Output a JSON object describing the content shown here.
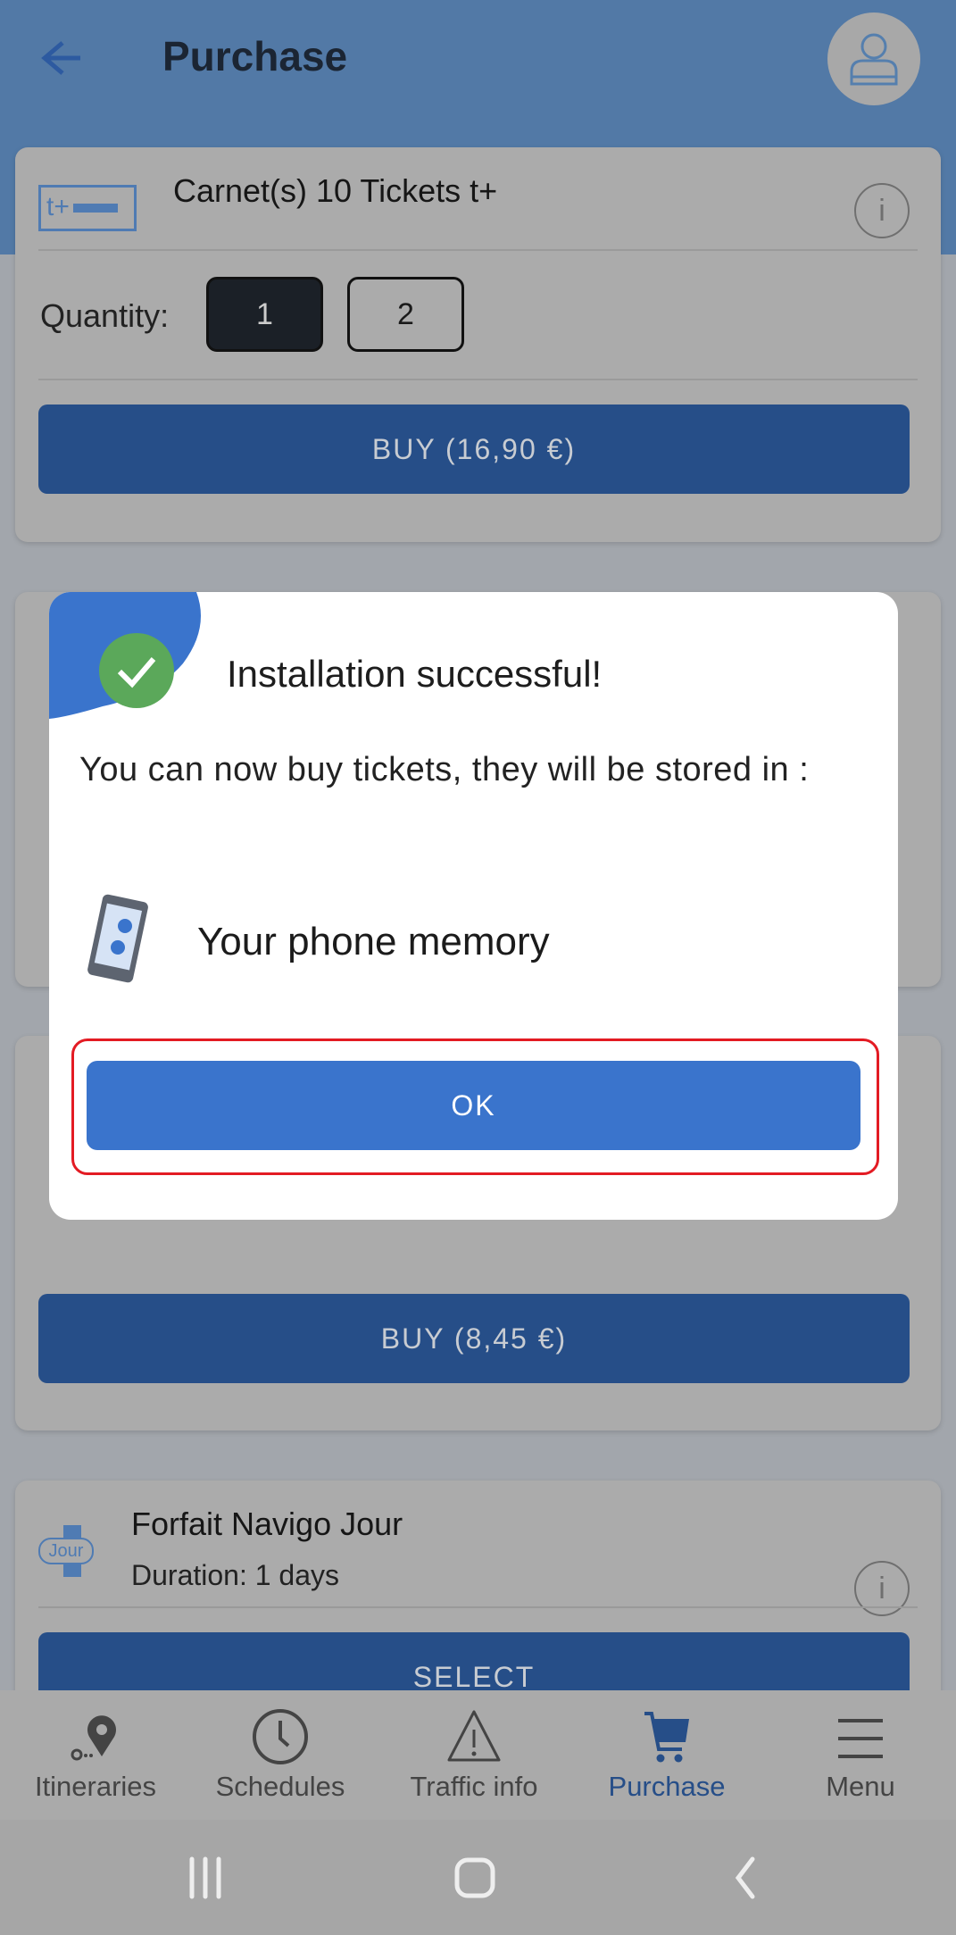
{
  "header": {
    "title": "Purchase",
    "back_icon": "arrow-left-icon",
    "avatar_icon": "user-icon"
  },
  "products": [
    {
      "icon_text": "t+",
      "title": "Carnet(s) 10 Tickets t+",
      "quantity_label": "Quantity:",
      "quantities": [
        "1",
        "2"
      ],
      "selected_quantity": "1",
      "buy_label": "BUY (16,90 €)"
    },
    {
      "buy_label": "BUY (8,45 €)"
    },
    {
      "icon_text": "Jour",
      "title": "Forfait Navigo Jour",
      "subtitle": "Duration: 1 days",
      "select_label": "SELECT"
    }
  ],
  "dialog": {
    "title": "Installation successful!",
    "body": "You can now buy tickets, they will be stored in :",
    "storage": "Your phone memory",
    "ok_label": "OK"
  },
  "bottom_nav": [
    {
      "label": "Itineraries",
      "icon": "map-pin-icon"
    },
    {
      "label": "Schedules",
      "icon": "clock-icon"
    },
    {
      "label": "Traffic info",
      "icon": "warning-icon"
    },
    {
      "label": "Purchase",
      "icon": "cart-icon",
      "active": true
    },
    {
      "label": "Menu",
      "icon": "menu-icon"
    }
  ],
  "colors": {
    "accent": "#3a74cc",
    "success": "#5ba85a",
    "highlight": "#e31b23"
  }
}
